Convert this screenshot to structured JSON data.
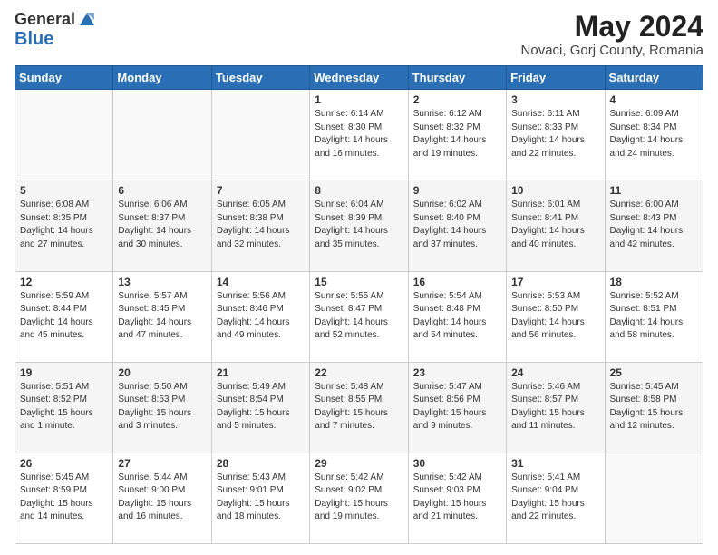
{
  "header": {
    "logo_general": "General",
    "logo_blue": "Blue",
    "month_year": "May 2024",
    "location": "Novaci, Gorj County, Romania"
  },
  "days_of_week": [
    "Sunday",
    "Monday",
    "Tuesday",
    "Wednesday",
    "Thursday",
    "Friday",
    "Saturday"
  ],
  "weeks": [
    [
      {
        "day": "",
        "info": ""
      },
      {
        "day": "",
        "info": ""
      },
      {
        "day": "",
        "info": ""
      },
      {
        "day": "1",
        "info": "Sunrise: 6:14 AM\nSunset: 8:30 PM\nDaylight: 14 hours\nand 16 minutes."
      },
      {
        "day": "2",
        "info": "Sunrise: 6:12 AM\nSunset: 8:32 PM\nDaylight: 14 hours\nand 19 minutes."
      },
      {
        "day": "3",
        "info": "Sunrise: 6:11 AM\nSunset: 8:33 PM\nDaylight: 14 hours\nand 22 minutes."
      },
      {
        "day": "4",
        "info": "Sunrise: 6:09 AM\nSunset: 8:34 PM\nDaylight: 14 hours\nand 24 minutes."
      }
    ],
    [
      {
        "day": "5",
        "info": "Sunrise: 6:08 AM\nSunset: 8:35 PM\nDaylight: 14 hours\nand 27 minutes."
      },
      {
        "day": "6",
        "info": "Sunrise: 6:06 AM\nSunset: 8:37 PM\nDaylight: 14 hours\nand 30 minutes."
      },
      {
        "day": "7",
        "info": "Sunrise: 6:05 AM\nSunset: 8:38 PM\nDaylight: 14 hours\nand 32 minutes."
      },
      {
        "day": "8",
        "info": "Sunrise: 6:04 AM\nSunset: 8:39 PM\nDaylight: 14 hours\nand 35 minutes."
      },
      {
        "day": "9",
        "info": "Sunrise: 6:02 AM\nSunset: 8:40 PM\nDaylight: 14 hours\nand 37 minutes."
      },
      {
        "day": "10",
        "info": "Sunrise: 6:01 AM\nSunset: 8:41 PM\nDaylight: 14 hours\nand 40 minutes."
      },
      {
        "day": "11",
        "info": "Sunrise: 6:00 AM\nSunset: 8:43 PM\nDaylight: 14 hours\nand 42 minutes."
      }
    ],
    [
      {
        "day": "12",
        "info": "Sunrise: 5:59 AM\nSunset: 8:44 PM\nDaylight: 14 hours\nand 45 minutes."
      },
      {
        "day": "13",
        "info": "Sunrise: 5:57 AM\nSunset: 8:45 PM\nDaylight: 14 hours\nand 47 minutes."
      },
      {
        "day": "14",
        "info": "Sunrise: 5:56 AM\nSunset: 8:46 PM\nDaylight: 14 hours\nand 49 minutes."
      },
      {
        "day": "15",
        "info": "Sunrise: 5:55 AM\nSunset: 8:47 PM\nDaylight: 14 hours\nand 52 minutes."
      },
      {
        "day": "16",
        "info": "Sunrise: 5:54 AM\nSunset: 8:48 PM\nDaylight: 14 hours\nand 54 minutes."
      },
      {
        "day": "17",
        "info": "Sunrise: 5:53 AM\nSunset: 8:50 PM\nDaylight: 14 hours\nand 56 minutes."
      },
      {
        "day": "18",
        "info": "Sunrise: 5:52 AM\nSunset: 8:51 PM\nDaylight: 14 hours\nand 58 minutes."
      }
    ],
    [
      {
        "day": "19",
        "info": "Sunrise: 5:51 AM\nSunset: 8:52 PM\nDaylight: 15 hours\nand 1 minute."
      },
      {
        "day": "20",
        "info": "Sunrise: 5:50 AM\nSunset: 8:53 PM\nDaylight: 15 hours\nand 3 minutes."
      },
      {
        "day": "21",
        "info": "Sunrise: 5:49 AM\nSunset: 8:54 PM\nDaylight: 15 hours\nand 5 minutes."
      },
      {
        "day": "22",
        "info": "Sunrise: 5:48 AM\nSunset: 8:55 PM\nDaylight: 15 hours\nand 7 minutes."
      },
      {
        "day": "23",
        "info": "Sunrise: 5:47 AM\nSunset: 8:56 PM\nDaylight: 15 hours\nand 9 minutes."
      },
      {
        "day": "24",
        "info": "Sunrise: 5:46 AM\nSunset: 8:57 PM\nDaylight: 15 hours\nand 11 minutes."
      },
      {
        "day": "25",
        "info": "Sunrise: 5:45 AM\nSunset: 8:58 PM\nDaylight: 15 hours\nand 12 minutes."
      }
    ],
    [
      {
        "day": "26",
        "info": "Sunrise: 5:45 AM\nSunset: 8:59 PM\nDaylight: 15 hours\nand 14 minutes."
      },
      {
        "day": "27",
        "info": "Sunrise: 5:44 AM\nSunset: 9:00 PM\nDaylight: 15 hours\nand 16 minutes."
      },
      {
        "day": "28",
        "info": "Sunrise: 5:43 AM\nSunset: 9:01 PM\nDaylight: 15 hours\nand 18 minutes."
      },
      {
        "day": "29",
        "info": "Sunrise: 5:42 AM\nSunset: 9:02 PM\nDaylight: 15 hours\nand 19 minutes."
      },
      {
        "day": "30",
        "info": "Sunrise: 5:42 AM\nSunset: 9:03 PM\nDaylight: 15 hours\nand 21 minutes."
      },
      {
        "day": "31",
        "info": "Sunrise: 5:41 AM\nSunset: 9:04 PM\nDaylight: 15 hours\nand 22 minutes."
      },
      {
        "day": "",
        "info": ""
      }
    ]
  ]
}
